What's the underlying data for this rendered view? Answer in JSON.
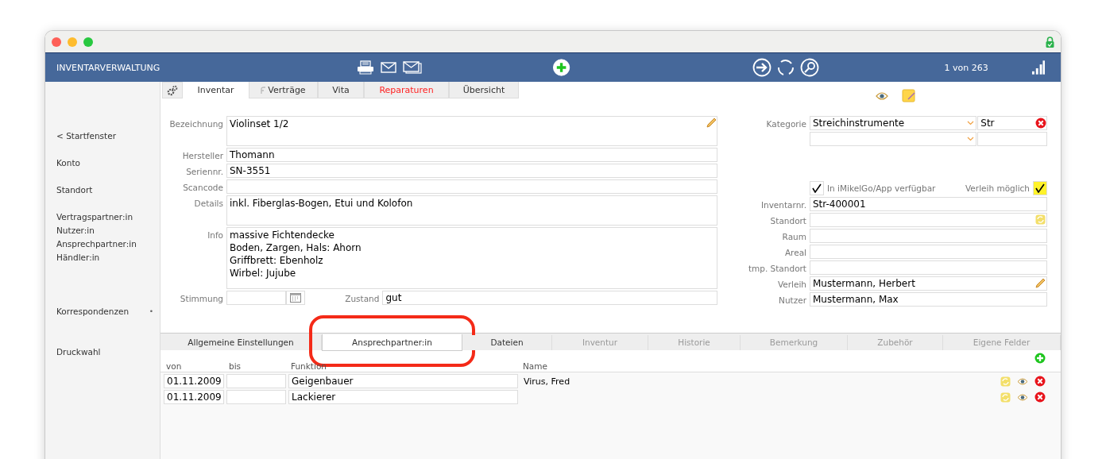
{
  "header": {
    "title": "INVENTARVERWALTUNG",
    "counter": "1 von 263"
  },
  "sidebar": {
    "groups": [
      [
        {
          "label": "< Startfenster"
        }
      ],
      [
        {
          "label": "Konto"
        }
      ],
      [
        {
          "label": "Standort"
        }
      ],
      [
        {
          "label": "Vertragspartner:in"
        },
        {
          "label": "Nutzer:in"
        },
        {
          "label": "Ansprechpartner:in"
        },
        {
          "label": "Händler:in"
        }
      ],
      [
        {
          "label": "Korrespondenzen",
          "marker": "•"
        }
      ],
      [
        {
          "label": "Druckwahl"
        }
      ]
    ]
  },
  "tabs": [
    {
      "label": "Inventar",
      "selected": true,
      "alert": false,
      "has_icon": false
    },
    {
      "label": "Verträge",
      "selected": false,
      "alert": false,
      "has_icon": true
    },
    {
      "label": "Vita",
      "selected": false,
      "alert": false,
      "has_icon": false
    },
    {
      "label": "Reparaturen",
      "selected": false,
      "alert": true,
      "has_icon": false
    },
    {
      "label": "Übersicht",
      "selected": false,
      "alert": false,
      "has_icon": false
    }
  ],
  "form_left": [
    {
      "kind": "multiline",
      "label": "Bezeichnung",
      "lines": [
        "Violinset 1/2"
      ],
      "pencil": true
    },
    {
      "kind": "text",
      "label": "Hersteller",
      "value": "Thomann"
    },
    {
      "kind": "text",
      "label": "Seriennr.",
      "value": "SN-3551"
    },
    {
      "kind": "text",
      "label": "Scancode"
    },
    {
      "kind": "multiline",
      "label": "Details",
      "lines": [
        "inkl. Fiberglas-Bogen, Etui und Kolofon"
      ]
    },
    {
      "kind": "multiline",
      "label": "Info",
      "lines": [
        "massive Fichtendecke",
        "Boden, Zargen, Hals: Ahorn",
        "Griffbrett: Ebenholz",
        "Wirbel: Jujube"
      ]
    },
    {
      "kind": "pair",
      "label": "Stimmung",
      "label_2": "Zustand",
      "value_2": "gut"
    }
  ],
  "form_right": [
    {
      "kind": "select",
      "label": "Kategorie",
      "value": "Streichinstrumente",
      "code": "Str",
      "clearable": true
    },
    {
      "kind": "select",
      "clearable": false
    },
    {
      "kind": "spacer"
    },
    {
      "kind": "checks",
      "items": [
        {
          "label": "In iMikelGo/App verfügbar",
          "checked": true,
          "color": "#ffffff"
        },
        {
          "label": "Verleih möglich",
          "checked": true,
          "color": "#fff22a"
        }
      ]
    },
    {
      "kind": "text",
      "label": "Inventarnr.",
      "value": "Str-400001"
    },
    {
      "kind": "text",
      "label": "Standort",
      "refresh": true
    },
    {
      "kind": "text",
      "label": "Raum"
    },
    {
      "kind": "text",
      "label": "Areal"
    },
    {
      "kind": "text",
      "label": "tmp. Standort"
    },
    {
      "kind": "text",
      "label": "Verleih",
      "value": "Mustermann, Herbert",
      "pencil": true
    },
    {
      "kind": "text",
      "label": "Nutzer",
      "value": "Mustermann, Max"
    }
  ],
  "subtabs": [
    {
      "label": "Allgemeine Einstellungen",
      "selected": false,
      "disabled": false,
      "highlighted": false
    },
    {
      "label": "Ansprechpartner:in",
      "selected": true,
      "disabled": false,
      "highlighted": true
    },
    {
      "label": "Dateien",
      "selected": false,
      "disabled": false,
      "highlighted": false
    },
    {
      "label": "Inventur",
      "selected": false,
      "disabled": true,
      "highlighted": false
    },
    {
      "label": "Historie",
      "selected": false,
      "disabled": true,
      "highlighted": false
    },
    {
      "label": "Bemerkung",
      "selected": false,
      "disabled": true,
      "highlighted": false
    },
    {
      "label": "Zubehör",
      "selected": false,
      "disabled": true,
      "highlighted": false
    },
    {
      "label": "Eigene Felder",
      "selected": false,
      "disabled": true,
      "highlighted": false
    }
  ],
  "contacts": {
    "columns": [
      "von",
      "bis",
      "Funktion",
      "Name"
    ],
    "rows": [
      {
        "von": "01.11.2009",
        "funktion": "Geigenbauer",
        "name": "Virus, Fred"
      },
      {
        "von": "01.11.2009",
        "funktion": "Lackierer"
      }
    ]
  }
}
